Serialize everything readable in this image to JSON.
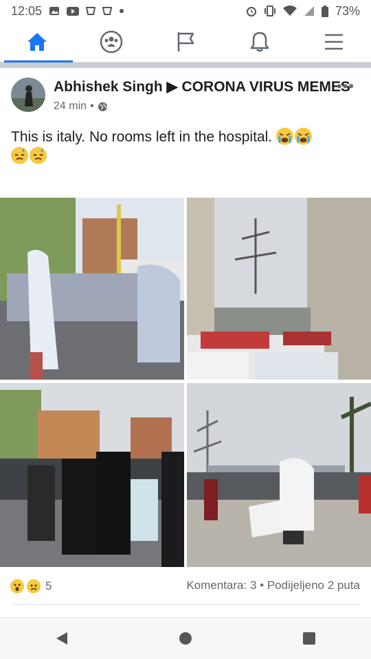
{
  "status": {
    "time": "12:05",
    "battery": "73%",
    "left_icons": [
      "gallery-icon",
      "youtube-icon",
      "app-icon",
      "app-icon",
      "dot-icon"
    ],
    "right_icons": [
      "alarm-icon",
      "vibrate-icon",
      "wifi-icon",
      "signal-icon",
      "battery-icon"
    ]
  },
  "nav": {
    "tabs": [
      "home-icon",
      "groups-icon",
      "pages-flag-icon",
      "notifications-bell-icon",
      "menu-icon"
    ],
    "active_color": "#1877f2"
  },
  "post": {
    "author": "Abhishek Singh",
    "arrow": "▶",
    "group": "CORONA VIRUS MEMES",
    "time": "24 min",
    "dot": "•",
    "privacy_icon": "globe-icon",
    "more_label": "•••",
    "text": "This is italy. No rooms left in the hospital.",
    "text_emojis": [
      "crying-face",
      "crying-face",
      "sweat-face",
      "sweat-face"
    ],
    "photos": [
      {
        "icon": "photo-1"
      },
      {
        "icon": "photo-2"
      },
      {
        "icon": "photo-3"
      },
      {
        "icon": "photo-4"
      }
    ]
  },
  "engagement": {
    "reaction_icons": [
      "wow-icon",
      "sad-icon"
    ],
    "reactions_count": "5",
    "comments": "Komentara: 3",
    "sep": "•",
    "shares": "Podijeljeno 2 puta"
  },
  "system_nav": [
    "back-icon",
    "home-circle-icon",
    "recents-icon"
  ]
}
